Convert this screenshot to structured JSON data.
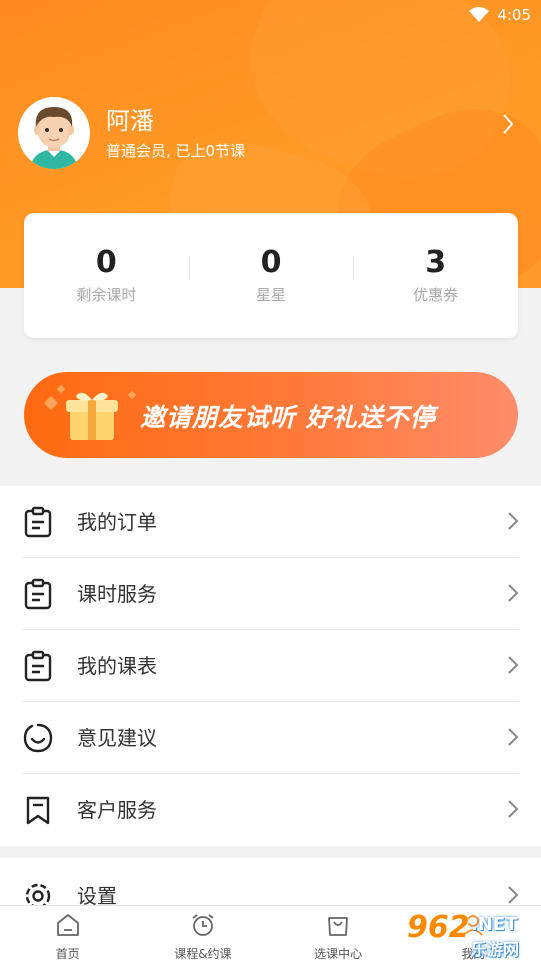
{
  "status_bar": {
    "time": "4:05",
    "icons": [
      "wifi-icon",
      "battery-icon"
    ]
  },
  "profile": {
    "name": "阿潘",
    "subtitle": "普通会员, 已上0节课",
    "avatar_icon": "avatar-boy"
  },
  "stats": [
    {
      "value": "0",
      "label": "剩余课时"
    },
    {
      "value": "0",
      "label": "星星"
    },
    {
      "value": "3",
      "label": "优惠券"
    }
  ],
  "invite_banner": {
    "text": "邀请朋友试听 好礼送不停",
    "icon": "gift-icon"
  },
  "menu": [
    {
      "label": "我的订单",
      "icon": "clipboard-icon"
    },
    {
      "label": "课时服务",
      "icon": "clipboard-icon"
    },
    {
      "label": "我的课表",
      "icon": "clipboard-icon"
    },
    {
      "label": "意见建议",
      "icon": "smile-bubble-icon"
    },
    {
      "label": "客户服务",
      "icon": "bookmark-icon"
    }
  ],
  "menu_secondary": [
    {
      "label": "设置",
      "icon": "gear-icon"
    }
  ],
  "tabbar": [
    {
      "label": "首页",
      "icon": "home-icon"
    },
    {
      "label": "课程&约课",
      "icon": "alarm-clock-icon"
    },
    {
      "label": "选课中心",
      "icon": "shopping-bag-icon"
    },
    {
      "label": "我的",
      "icon": "user-icon"
    }
  ],
  "watermark": {
    "number": "962",
    "net": ".NET",
    "site": "乐游网"
  },
  "colors": {
    "primary": "#ff8a1f",
    "banner_start": "#ff6a10",
    "banner_end": "#ff8c6a",
    "text": "#333333",
    "muted": "#a8a8a8"
  }
}
